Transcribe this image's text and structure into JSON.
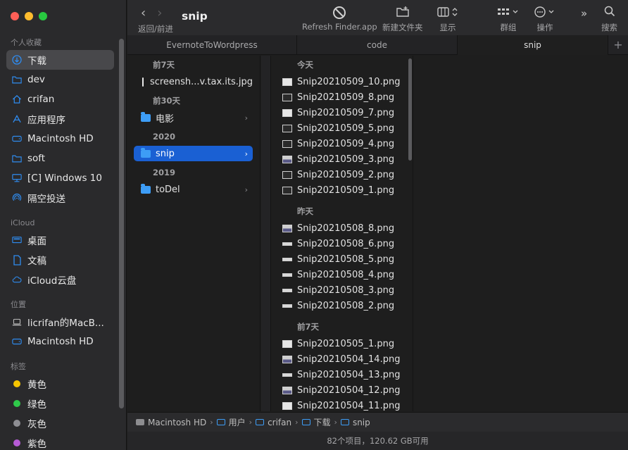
{
  "window": {
    "title": "snip"
  },
  "sidebar": {
    "favorites_header": "个人收藏",
    "favorites": [
      {
        "label": "下载",
        "icon": "download-icon",
        "selected": true
      },
      {
        "label": "dev",
        "icon": "folder-icon"
      },
      {
        "label": "crifan",
        "icon": "home-icon"
      },
      {
        "label": "应用程序",
        "icon": "applications-icon"
      },
      {
        "label": "Macintosh HD",
        "icon": "drive-icon"
      },
      {
        "label": "soft",
        "icon": "folder-icon"
      },
      {
        "label": "[C] Windows 10",
        "icon": "network-drive-icon"
      },
      {
        "label": "隔空投送",
        "icon": "airdrop-icon"
      }
    ],
    "icloud_header": "iCloud",
    "icloud": [
      {
        "label": "桌面",
        "icon": "desktop-icon"
      },
      {
        "label": "文稿",
        "icon": "document-icon"
      },
      {
        "label": "iCloud云盘",
        "icon": "cloud-icon"
      }
    ],
    "locations_header": "位置",
    "locations": [
      {
        "label": "licrifan的MacB...",
        "icon": "laptop-icon"
      },
      {
        "label": "Macintosh HD",
        "icon": "drive-icon"
      }
    ],
    "tags_header": "标签",
    "tags": [
      {
        "label": "黄色",
        "color": "#f5c400"
      },
      {
        "label": "绿色",
        "color": "#2fc94a"
      },
      {
        "label": "灰色",
        "color": "#8e8e93"
      },
      {
        "label": "紫色",
        "color": "#b65bd6"
      }
    ]
  },
  "toolbar": {
    "nav_label": "返回/前进",
    "refresh_label": "Refresh Finder.app",
    "new_folder_label": "新建文件夹",
    "display_label": "显示",
    "group_label": "群组",
    "action_label": "操作",
    "search_label": "搜索"
  },
  "tabs": [
    {
      "label": "EvernoteToWordpress",
      "active": false
    },
    {
      "label": "code",
      "active": false
    },
    {
      "label": "snip",
      "active": true
    }
  ],
  "column1": [
    {
      "group": "前7天",
      "items": [
        {
          "label": "screensh...v.tax.its.jpg",
          "kind": "file"
        }
      ]
    },
    {
      "group": "前30天",
      "items": [
        {
          "label": "电影",
          "kind": "folder"
        }
      ]
    },
    {
      "group": "2020",
      "items": [
        {
          "label": "snip",
          "kind": "folder",
          "selected": true
        }
      ]
    },
    {
      "group": "2019",
      "items": [
        {
          "label": "toDel",
          "kind": "folder"
        }
      ]
    }
  ],
  "column2": [
    {
      "group": "今天",
      "items": [
        {
          "label": "Snip20210509_10.png",
          "thumb": "light"
        },
        {
          "label": "Snip20210509_8.png",
          "thumb": "dark"
        },
        {
          "label": "Snip20210509_7.png",
          "thumb": "light"
        },
        {
          "label": "Snip20210509_5.png",
          "thumb": "dark"
        },
        {
          "label": "Snip20210509_4.png",
          "thumb": "dark"
        },
        {
          "label": "Snip20210509_3.png",
          "thumb": "pic"
        },
        {
          "label": "Snip20210509_2.png",
          "thumb": "dark"
        },
        {
          "label": "Snip20210509_1.png",
          "thumb": "dark"
        }
      ]
    },
    {
      "group": "昨天",
      "items": [
        {
          "label": "Snip20210508_8.png",
          "thumb": "pic"
        },
        {
          "label": "Snip20210508_6.png",
          "thumb": "thin"
        },
        {
          "label": "Snip20210508_5.png",
          "thumb": "thin"
        },
        {
          "label": "Snip20210508_4.png",
          "thumb": "thin"
        },
        {
          "label": "Snip20210508_3.png",
          "thumb": "thin"
        },
        {
          "label": "Snip20210508_2.png",
          "thumb": "thin"
        }
      ]
    },
    {
      "group": "前7天",
      "items": [
        {
          "label": "Snip20210505_1.png",
          "thumb": "light"
        },
        {
          "label": "Snip20210504_14.png",
          "thumb": "pic"
        },
        {
          "label": "Snip20210504_13.png",
          "thumb": "thin"
        },
        {
          "label": "Snip20210504_12.png",
          "thumb": "pic"
        },
        {
          "label": "Snip20210504_11.png",
          "thumb": "light"
        }
      ]
    }
  ],
  "pathbar": [
    {
      "label": "Macintosh HD",
      "icon": "drive-icon"
    },
    {
      "label": "用户",
      "icon": "folder-icon"
    },
    {
      "label": "crifan",
      "icon": "folder-icon"
    },
    {
      "label": "下载",
      "icon": "folder-icon"
    },
    {
      "label": "snip",
      "icon": "folder-icon"
    }
  ],
  "status": "82个项目，120.62 GB可用"
}
